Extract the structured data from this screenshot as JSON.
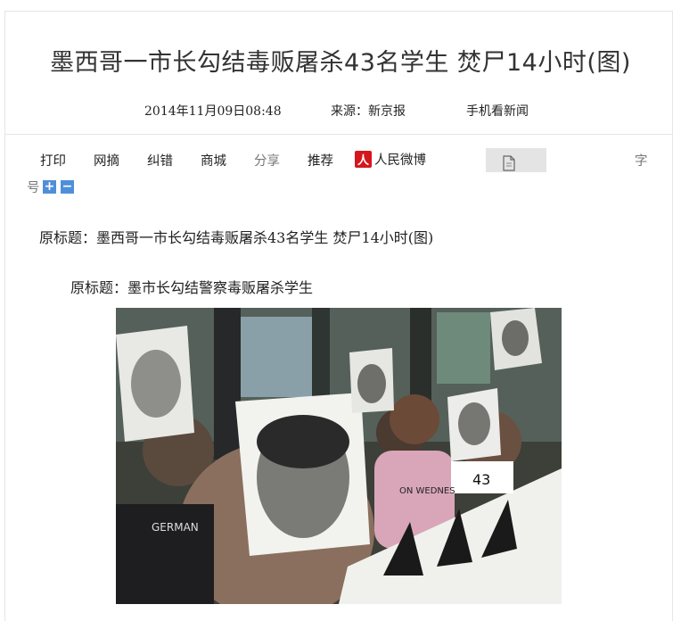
{
  "article": {
    "title": "墨西哥一市长勾结毒贩屠杀43名学生 焚尸14小时(图)",
    "date": "2014年11月09日08:48",
    "source": "来源：新京报",
    "mobile_link": "手机看新闻"
  },
  "toolbar": {
    "print": "打印",
    "web_excerpt": "网摘",
    "correction": "纠错",
    "mall": "商城",
    "share": "分享",
    "recommend": "推荐",
    "weibo_logo": "人",
    "weibo": "人民微博",
    "font_size_1": "字",
    "font_size_2": "号",
    "plus": "+",
    "minus": "−"
  },
  "body": {
    "original_title_1": "原标题：墨西哥一市长勾结毒贩屠杀43名学生 焚尸14小时(图)",
    "original_title_2": "原标题：墨市长勾结警察毒贩屠杀学生",
    "photo_sign_text": "ON WEDNES",
    "photo_sign_43": "43",
    "photo_sign_german": "GERMAN"
  },
  "colors": {
    "weibo_red": "#d5161d",
    "font_button_blue": "#4f8fd9"
  },
  "icons": [
    "weibo-logo-icon",
    "document-icon"
  ]
}
